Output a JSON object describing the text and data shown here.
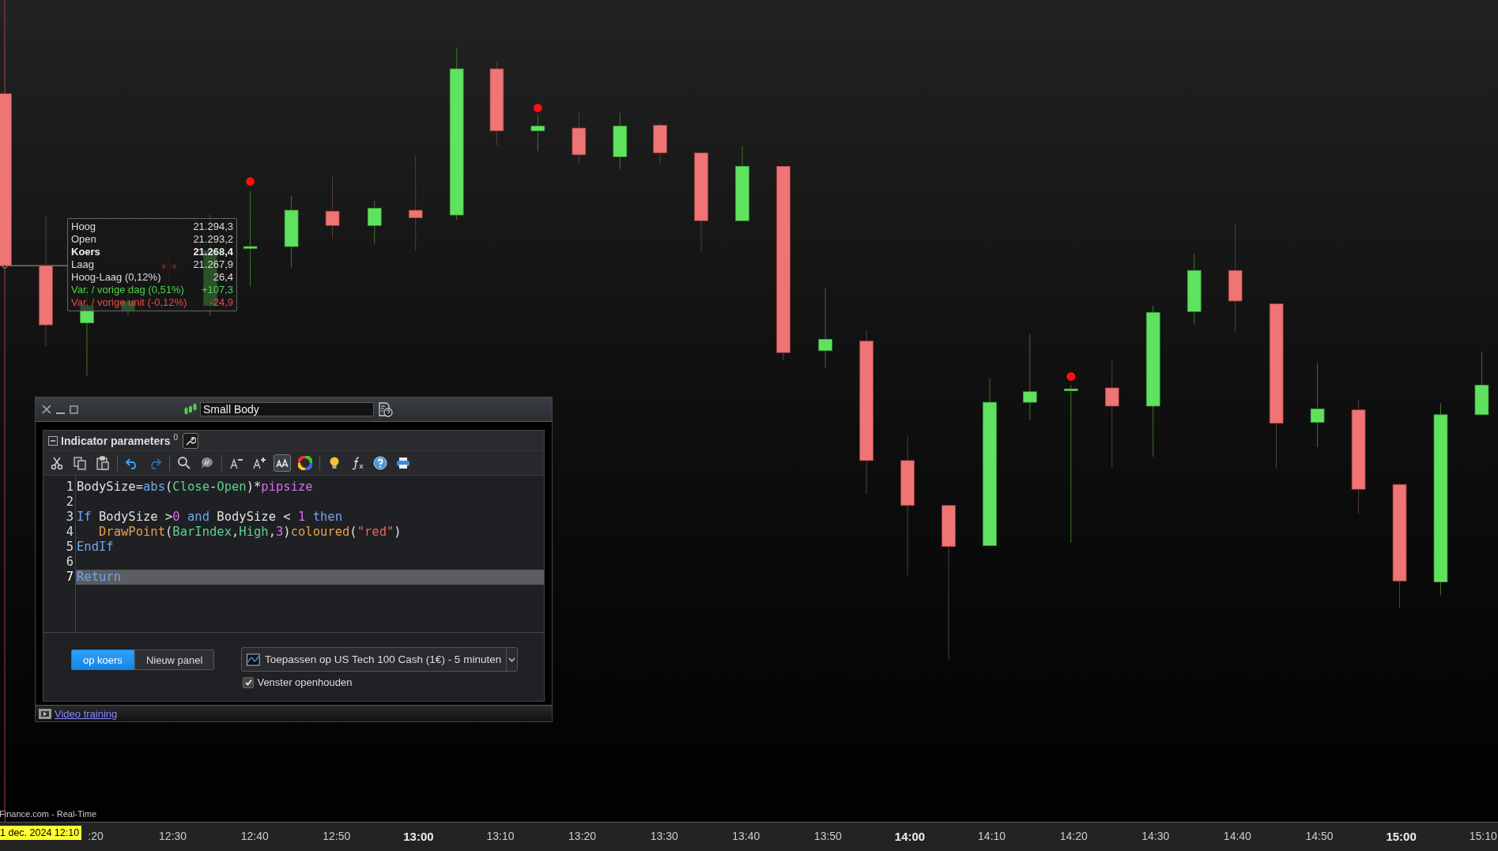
{
  "chart": {
    "source_label": "Finance.com - Real-Time",
    "cursor_date": "1 dec. 2024 12:10",
    "time_axis": [
      {
        "label": ":20",
        "major": false
      },
      {
        "label": "12:30",
        "major": false
      },
      {
        "label": "12:40",
        "major": false
      },
      {
        "label": "12:50",
        "major": false
      },
      {
        "label": "13:00",
        "major": true
      },
      {
        "label": "13:10",
        "major": false
      },
      {
        "label": "13:20",
        "major": false
      },
      {
        "label": "13:30",
        "major": false
      },
      {
        "label": "13:40",
        "major": false
      },
      {
        "label": "13:50",
        "major": false
      },
      {
        "label": "14:00",
        "major": true
      },
      {
        "label": "14:10",
        "major": false
      },
      {
        "label": "14:20",
        "major": false
      },
      {
        "label": "14:30",
        "major": false
      },
      {
        "label": "14:40",
        "major": false
      },
      {
        "label": "14:50",
        "major": false
      },
      {
        "label": "15:00",
        "major": true
      },
      {
        "label": "15:10",
        "major": false
      }
    ]
  },
  "tooltip": {
    "rows": [
      {
        "label": "Hoog",
        "value": "21.294,3",
        "kind": "normal"
      },
      {
        "label": "Open",
        "value": "21.293,2",
        "kind": "normal"
      },
      {
        "label": "Koers",
        "value": "21.268,4",
        "kind": "bold"
      },
      {
        "label": "Laag",
        "value": "21.267,9",
        "kind": "normal"
      },
      {
        "label": "Hoog-Laag (0,12%)",
        "value": "26,4",
        "kind": "normal"
      },
      {
        "label": "Var. / vorige dag (0,51%)",
        "value": "+107,3",
        "kind": "up"
      },
      {
        "label": "Var. / vorige unit (-0,12%)",
        "value": "-24,9",
        "kind": "down"
      }
    ]
  },
  "indicator_window": {
    "name": "Small Body",
    "panel": {
      "title": "Indicator parameters",
      "count": "0"
    },
    "aa_toggle_on": true,
    "code_lines": [
      {
        "number": "1",
        "selected": false,
        "tokens": [
          {
            "t": "BodySize=",
            "kind": "plain"
          },
          {
            "t": "abs",
            "kind": "keyword"
          },
          {
            "t": "(",
            "kind": "plain"
          },
          {
            "t": "Close",
            "kind": "builtin"
          },
          {
            "t": "-",
            "kind": "plain"
          },
          {
            "t": "Open",
            "kind": "builtin"
          },
          {
            "t": ")*",
            "kind": "plain"
          },
          {
            "t": "pipsize",
            "kind": "number"
          }
        ]
      },
      {
        "number": "2",
        "selected": false
      },
      {
        "number": "3",
        "selected": false,
        "tokens": [
          {
            "t": "If",
            "kind": "keyword"
          },
          {
            "t": " BodySize >",
            "kind": "plain"
          },
          {
            "t": "0",
            "kind": "number"
          },
          {
            "t": " and",
            "kind": "keyword"
          },
          {
            "t": " BodySize < ",
            "kind": "plain"
          },
          {
            "t": "1",
            "kind": "number"
          },
          {
            "t": " then",
            "kind": "keyword"
          }
        ]
      },
      {
        "number": "4",
        "selected": false,
        "tokens": [
          {
            "t": "   DrawPoint",
            "kind": "function"
          },
          {
            "t": "(",
            "kind": "plain"
          },
          {
            "t": "BarIndex",
            "kind": "builtin"
          },
          {
            "t": ",",
            "kind": "plain"
          },
          {
            "t": "High",
            "kind": "builtin"
          },
          {
            "t": ",",
            "kind": "plain"
          },
          {
            "t": "3",
            "kind": "number"
          },
          {
            "t": ")",
            "kind": "plain"
          },
          {
            "t": "coloured",
            "kind": "function"
          },
          {
            "t": "(",
            "kind": "plain"
          },
          {
            "t": "\"red\"",
            "kind": "string"
          },
          {
            "t": ")",
            "kind": "plain"
          }
        ]
      },
      {
        "number": "5",
        "selected": false,
        "tokens": [
          {
            "t": "EndIf",
            "kind": "keyword"
          }
        ]
      },
      {
        "number": "6",
        "selected": false
      },
      {
        "number": "7",
        "selected": true,
        "tokens": [
          {
            "t": "Return",
            "kind": "keyword"
          }
        ]
      }
    ],
    "placement": [
      {
        "label": "op koers",
        "selected": true
      },
      {
        "label": "Nieuw panel",
        "selected": false
      }
    ],
    "apply_target": "Toepassen op US Tech 100 Cash (1€) - 5 minuten",
    "keep_open": {
      "label": "Venster openhouden",
      "checked": true
    },
    "footer_link": "Video training"
  }
}
